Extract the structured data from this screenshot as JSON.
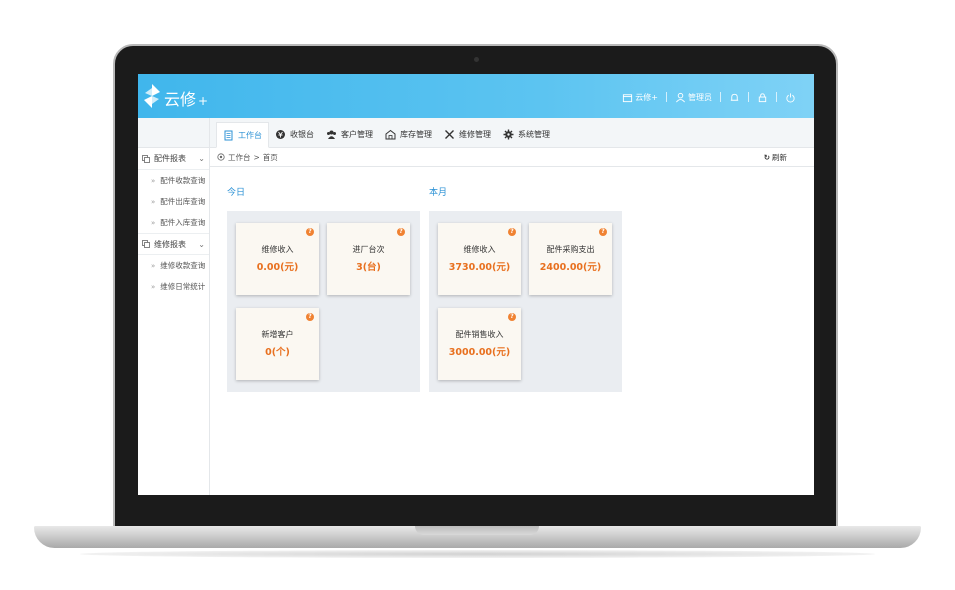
{
  "app": {
    "brand": "云修",
    "brand_plus": "+"
  },
  "topbar": {
    "app_menu": "云修+",
    "user": "管理员"
  },
  "tabs": [
    {
      "label": "工作台",
      "icon": "document-icon",
      "active": true
    },
    {
      "label": "收银台",
      "icon": "cashier-icon"
    },
    {
      "label": "客户管理",
      "icon": "users-icon"
    },
    {
      "label": "库存管理",
      "icon": "warehouse-icon"
    },
    {
      "label": "维修管理",
      "icon": "tools-icon"
    },
    {
      "label": "系统管理",
      "icon": "gear-icon"
    }
  ],
  "breadcrumb": {
    "root": "工作台",
    "sep": ">",
    "current": "首页"
  },
  "refresh_label": "刷新",
  "sidebar": {
    "groups": [
      {
        "label": "配件报表",
        "items": [
          "配件收款查询",
          "配件出库查询",
          "配件入库查询"
        ]
      },
      {
        "label": "维修报表",
        "items": [
          "维修收款查询",
          "维修日常统计"
        ]
      }
    ]
  },
  "today": {
    "title": "今日",
    "cards": [
      {
        "label": "维修收入",
        "value": "0.00(元)"
      },
      {
        "label": "进厂台次",
        "value": "3(台)"
      },
      {
        "label": "新增客户",
        "value": "0(个)"
      }
    ]
  },
  "month": {
    "title": "本月",
    "cards": [
      {
        "label": "维修收入",
        "value": "3730.00(元)"
      },
      {
        "label": "配件采购支出",
        "value": "2400.00(元)"
      },
      {
        "label": "配件销售收入",
        "value": "3000.00(元)"
      }
    ]
  },
  "colors": {
    "topbar": "#40b6ec",
    "accent": "#2b91d5",
    "value": "#e8701f",
    "help_badge": "#f08232"
  },
  "help_mark": "?"
}
